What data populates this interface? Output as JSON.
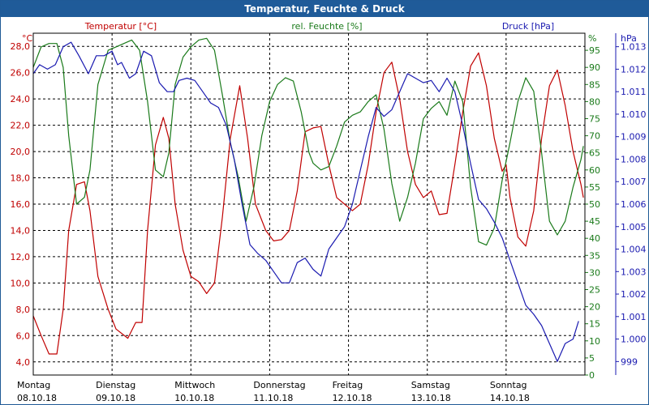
{
  "window": {
    "title": "Temperatur, Feuchte & Druck"
  },
  "colors": {
    "temperature": "#c00000",
    "humidity": "#1a7a1a",
    "pressure": "#1a1ab0",
    "grid": "#000000",
    "titlebar": "#1f5b99"
  },
  "chart_data": {
    "type": "line",
    "title": "Temperatur, Feuchte & Druck",
    "grid": true,
    "x_axis": {
      "ticks": [
        {
          "day": "Montag",
          "date": "08.10.18"
        },
        {
          "day": "Dienstag",
          "date": "09.10.18"
        },
        {
          "day": "Mittwoch",
          "date": "10.10.18"
        },
        {
          "day": "Donnerstag",
          "date": "11.10.18"
        },
        {
          "day": "Freitag",
          "date": "12.10.18"
        },
        {
          "day": "Samstag",
          "date": "13.10.18"
        },
        {
          "day": "Sonntag",
          "date": "14.10.18"
        }
      ],
      "range": [
        0,
        7
      ]
    },
    "axes": {
      "left": {
        "unit": "°C",
        "ylim": [
          3,
          29
        ],
        "ticks": [
          "4,0",
          "6,0",
          "8,0",
          "10,0",
          "12,0",
          "14,0",
          "16,0",
          "18,0",
          "20,0",
          "22,0",
          "24,0",
          "26,0",
          "28,0"
        ],
        "tick_values": [
          4,
          6,
          8,
          10,
          12,
          14,
          16,
          18,
          20,
          22,
          24,
          26,
          28
        ]
      },
      "mid": {
        "unit": "%",
        "ylim": [
          0,
          100
        ],
        "ticks": [
          "0",
          "5",
          "10",
          "15",
          "20",
          "25",
          "30",
          "35",
          "40",
          "45",
          "50",
          "55",
          "60",
          "65",
          "70",
          "75",
          "80",
          "85",
          "90",
          "95"
        ],
        "tick_values": [
          0,
          5,
          10,
          15,
          20,
          25,
          30,
          35,
          40,
          45,
          50,
          55,
          60,
          65,
          70,
          75,
          80,
          85,
          90,
          95
        ]
      },
      "right": {
        "unit": "hPa",
        "ylim": [
          998.4,
          1013.6
        ],
        "ticks": [
          "999",
          "1.000",
          "1.001",
          "1.002",
          "1.003",
          "1.004",
          "1.005",
          "1.006",
          "1.007",
          "1.008",
          "1.009",
          "1.010",
          "1.011",
          "1.012",
          "1.013"
        ],
        "tick_values": [
          999,
          1000,
          1001,
          1002,
          1003,
          1004,
          1005,
          1006,
          1007,
          1008,
          1009,
          1010,
          1011,
          1012,
          1013
        ]
      }
    },
    "series": [
      {
        "name": "Temperatur [°C]",
        "axis": "left",
        "color": "#c00000",
        "points": [
          [
            0,
            7.5
          ],
          [
            0.1,
            6
          ],
          [
            0.2,
            4.6
          ],
          [
            0.3,
            4.6
          ],
          [
            0.38,
            8
          ],
          [
            0.45,
            14
          ],
          [
            0.55,
            17.5
          ],
          [
            0.65,
            17.7
          ],
          [
            0.72,
            15.5
          ],
          [
            0.82,
            10.5
          ],
          [
            0.95,
            8
          ],
          [
            1.05,
            6.5
          ],
          [
            1.2,
            5.8
          ],
          [
            1.3,
            7
          ],
          [
            1.38,
            7
          ],
          [
            1.45,
            14
          ],
          [
            1.55,
            20.5
          ],
          [
            1.65,
            22.6
          ],
          [
            1.72,
            21
          ],
          [
            1.8,
            16
          ],
          [
            1.9,
            12.5
          ],
          [
            2.0,
            10.5
          ],
          [
            2.1,
            10.1
          ],
          [
            2.2,
            9.2
          ],
          [
            2.3,
            10
          ],
          [
            2.4,
            15
          ],
          [
            2.5,
            21
          ],
          [
            2.62,
            25
          ],
          [
            2.72,
            21
          ],
          [
            2.82,
            16
          ],
          [
            2.95,
            14
          ],
          [
            3.05,
            13.2
          ],
          [
            3.15,
            13.3
          ],
          [
            3.25,
            14
          ],
          [
            3.35,
            17
          ],
          [
            3.45,
            21.5
          ],
          [
            3.55,
            21.8
          ],
          [
            3.65,
            21.9
          ],
          [
            3.75,
            19
          ],
          [
            3.85,
            16.5
          ],
          [
            3.95,
            16
          ],
          [
            4.05,
            15.5
          ],
          [
            4.15,
            16
          ],
          [
            4.25,
            19
          ],
          [
            4.35,
            23
          ],
          [
            4.45,
            26
          ],
          [
            4.55,
            26.8
          ],
          [
            4.65,
            24
          ],
          [
            4.75,
            20
          ],
          [
            4.85,
            17.5
          ],
          [
            4.95,
            16.5
          ],
          [
            5.05,
            17
          ],
          [
            5.15,
            15.2
          ],
          [
            5.25,
            15.3
          ],
          [
            5.35,
            19
          ],
          [
            5.45,
            23
          ],
          [
            5.55,
            26.5
          ],
          [
            5.65,
            27.5
          ],
          [
            5.75,
            25
          ],
          [
            5.85,
            21
          ],
          [
            5.95,
            18.5
          ],
          [
            6.0,
            19
          ],
          [
            6.05,
            16.5
          ],
          [
            6.15,
            13.5
          ],
          [
            6.25,
            12.8
          ],
          [
            6.35,
            15.5
          ],
          [
            6.45,
            21
          ],
          [
            6.55,
            25
          ],
          [
            6.65,
            26.2
          ],
          [
            6.75,
            23.5
          ],
          [
            6.85,
            20
          ],
          [
            6.95,
            17.5
          ],
          [
            6.98,
            16.5
          ]
        ]
      },
      {
        "name": "rel. Feuchte [%]",
        "axis": "mid",
        "color": "#1a7a1a",
        "points": [
          [
            0,
            90
          ],
          [
            0.1,
            96
          ],
          [
            0.2,
            97
          ],
          [
            0.3,
            97
          ],
          [
            0.38,
            90
          ],
          [
            0.45,
            70
          ],
          [
            0.55,
            50
          ],
          [
            0.65,
            52
          ],
          [
            0.72,
            60
          ],
          [
            0.82,
            85
          ],
          [
            0.95,
            95
          ],
          [
            1.05,
            96
          ],
          [
            1.15,
            97
          ],
          [
            1.25,
            98
          ],
          [
            1.35,
            95
          ],
          [
            1.45,
            80
          ],
          [
            1.55,
            60
          ],
          [
            1.65,
            58
          ],
          [
            1.72,
            65
          ],
          [
            1.8,
            85
          ],
          [
            1.9,
            93
          ],
          [
            2.0,
            96
          ],
          [
            2.1,
            98
          ],
          [
            2.2,
            98.5
          ],
          [
            2.3,
            95
          ],
          [
            2.4,
            82
          ],
          [
            2.5,
            68
          ],
          [
            2.6,
            58
          ],
          [
            2.7,
            45
          ],
          [
            2.8,
            55
          ],
          [
            2.9,
            70
          ],
          [
            3.0,
            80
          ],
          [
            3.1,
            85
          ],
          [
            3.2,
            87
          ],
          [
            3.3,
            86
          ],
          [
            3.4,
            77
          ],
          [
            3.5,
            65
          ],
          [
            3.55,
            62
          ],
          [
            3.65,
            60
          ],
          [
            3.75,
            61
          ],
          [
            3.85,
            67
          ],
          [
            3.95,
            74
          ],
          [
            4.05,
            76
          ],
          [
            4.15,
            77
          ],
          [
            4.25,
            80
          ],
          [
            4.35,
            82
          ],
          [
            4.45,
            72
          ],
          [
            4.55,
            56
          ],
          [
            4.65,
            45
          ],
          [
            4.75,
            52
          ],
          [
            4.85,
            62
          ],
          [
            4.95,
            75
          ],
          [
            5.05,
            78
          ],
          [
            5.15,
            80
          ],
          [
            5.25,
            76
          ],
          [
            5.35,
            86
          ],
          [
            5.45,
            80
          ],
          [
            5.55,
            55
          ],
          [
            5.65,
            39
          ],
          [
            5.75,
            38
          ],
          [
            5.85,
            43
          ],
          [
            5.95,
            57
          ],
          [
            6.05,
            68
          ],
          [
            6.15,
            80
          ],
          [
            6.25,
            87
          ],
          [
            6.35,
            83
          ],
          [
            6.45,
            65
          ],
          [
            6.55,
            45
          ],
          [
            6.65,
            41
          ],
          [
            6.75,
            45
          ],
          [
            6.85,
            55
          ],
          [
            6.95,
            63
          ],
          [
            6.98,
            67
          ]
        ]
      },
      {
        "name": "Druck [hPa]",
        "axis": "right",
        "color": "#1a1ab0",
        "points": [
          [
            0,
            1011.8
          ],
          [
            0.08,
            1012.2
          ],
          [
            0.18,
            1012
          ],
          [
            0.28,
            1012.2
          ],
          [
            0.38,
            1013
          ],
          [
            0.48,
            1013.2
          ],
          [
            0.58,
            1012.6
          ],
          [
            0.7,
            1011.8
          ],
          [
            0.8,
            1012.6
          ],
          [
            0.9,
            1012.6
          ],
          [
            1.0,
            1012.8
          ],
          [
            1.07,
            1012.2
          ],
          [
            1.12,
            1012.3
          ],
          [
            1.22,
            1011.6
          ],
          [
            1.3,
            1011.8
          ],
          [
            1.4,
            1012.8
          ],
          [
            1.5,
            1012.6
          ],
          [
            1.6,
            1011.4
          ],
          [
            1.7,
            1011
          ],
          [
            1.78,
            1011
          ],
          [
            1.85,
            1011.5
          ],
          [
            1.95,
            1011.6
          ],
          [
            2.05,
            1011.5
          ],
          [
            2.15,
            1011
          ],
          [
            2.25,
            1010.5
          ],
          [
            2.35,
            1010.3
          ],
          [
            2.45,
            1009.5
          ],
          [
            2.55,
            1008
          ],
          [
            2.65,
            1006
          ],
          [
            2.75,
            1004.2
          ],
          [
            2.85,
            1003.8
          ],
          [
            2.95,
            1003.5
          ],
          [
            3.05,
            1003
          ],
          [
            3.15,
            1002.5
          ],
          [
            3.25,
            1002.5
          ],
          [
            3.35,
            1003.4
          ],
          [
            3.45,
            1003.6
          ],
          [
            3.55,
            1003.1
          ],
          [
            3.65,
            1002.8
          ],
          [
            3.75,
            1004
          ],
          [
            3.85,
            1004.5
          ],
          [
            3.95,
            1005
          ],
          [
            4.05,
            1006
          ],
          [
            4.15,
            1007.5
          ],
          [
            4.25,
            1009
          ],
          [
            4.35,
            1010.3
          ],
          [
            4.45,
            1009.9
          ],
          [
            4.55,
            1010.2
          ],
          [
            4.65,
            1011
          ],
          [
            4.75,
            1011.8
          ],
          [
            4.85,
            1011.6
          ],
          [
            4.95,
            1011.4
          ],
          [
            5.05,
            1011.5
          ],
          [
            5.15,
            1011
          ],
          [
            5.25,
            1011.6
          ],
          [
            5.35,
            1011
          ],
          [
            5.45,
            1009.5
          ],
          [
            5.55,
            1007.8
          ],
          [
            5.65,
            1006.2
          ],
          [
            5.75,
            1005.8
          ],
          [
            5.85,
            1005.2
          ],
          [
            5.95,
            1004.5
          ],
          [
            6.05,
            1003.5
          ],
          [
            6.15,
            1002.5
          ],
          [
            6.25,
            1001.5
          ],
          [
            6.35,
            1001.1
          ],
          [
            6.45,
            1000.6
          ],
          [
            6.55,
            999.8
          ],
          [
            6.65,
            999
          ],
          [
            6.75,
            999.8
          ],
          [
            6.85,
            1000
          ],
          [
            6.92,
            1000.8
          ]
        ]
      }
    ]
  }
}
